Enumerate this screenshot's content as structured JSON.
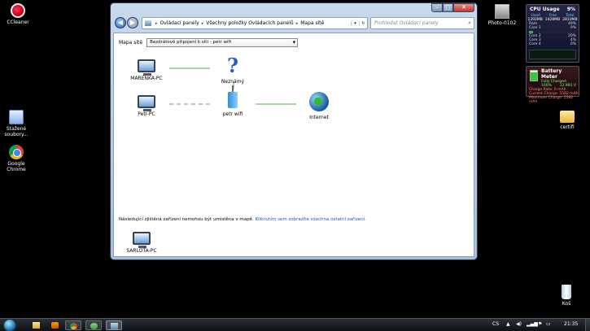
{
  "desktop": {
    "icons": [
      {
        "label": "CCleaner"
      },
      {
        "label": "Stažené soubory..."
      },
      {
        "label": "Google Chrome"
      },
      {
        "label": "Photo-0102"
      },
      {
        "label": "certifi"
      },
      {
        "label": "Koš"
      }
    ]
  },
  "gadgets": {
    "cpu": {
      "title": "CPU Usage",
      "value": "9%",
      "cols": [
        "Used",
        "Free",
        "Total"
      ],
      "vals": [
        "1392MB",
        "1428MB",
        "2810MB"
      ],
      "ram_label": "Ram",
      "ram_value": "49%",
      "cores": [
        {
          "label": "Core 1",
          "value": "9%",
          "pct": 9
        },
        {
          "label": "Core 2",
          "value": "20%",
          "pct": 20
        },
        {
          "label": "Core 3",
          "value": "4%",
          "pct": 4
        },
        {
          "label": "Core 4",
          "value": "0%",
          "pct": 0
        }
      ]
    },
    "battery": {
      "title": "Battery Meter",
      "status": "Fully Charged",
      "percent": "100%",
      "voltage": "12.991 V",
      "lines": [
        "Charge Rate: 0 mAh",
        "Current Charge: 5582 mAh",
        "Maximum Charge: 5582 mAh"
      ]
    }
  },
  "window": {
    "breadcrumb": [
      "Ovládací panely",
      "Všechny položky Ovládacích panelů",
      "Mapa sítě"
    ],
    "search_placeholder": "Prohledat Ovládací panely",
    "map_label": "Mapa sítě",
    "map_select": "Bezdrátové připojení k síti - petr wifi",
    "nodes": {
      "marenka": "MARENKA-PC",
      "unknown": "Neznámý",
      "petr_pc": "Petr-PC",
      "petr_wifi": "petr wifi",
      "internet": "Internet",
      "sarlota": "SARLOTA-PC"
    },
    "notice_text": "Následující zjištěná zařízení nemohou být umístěna v mapě.",
    "notice_link": "Kliknutím sem zobrazíte všechna ostatní zařízení."
  },
  "taskbar": {
    "lang": "CS",
    "time": "21:35"
  }
}
